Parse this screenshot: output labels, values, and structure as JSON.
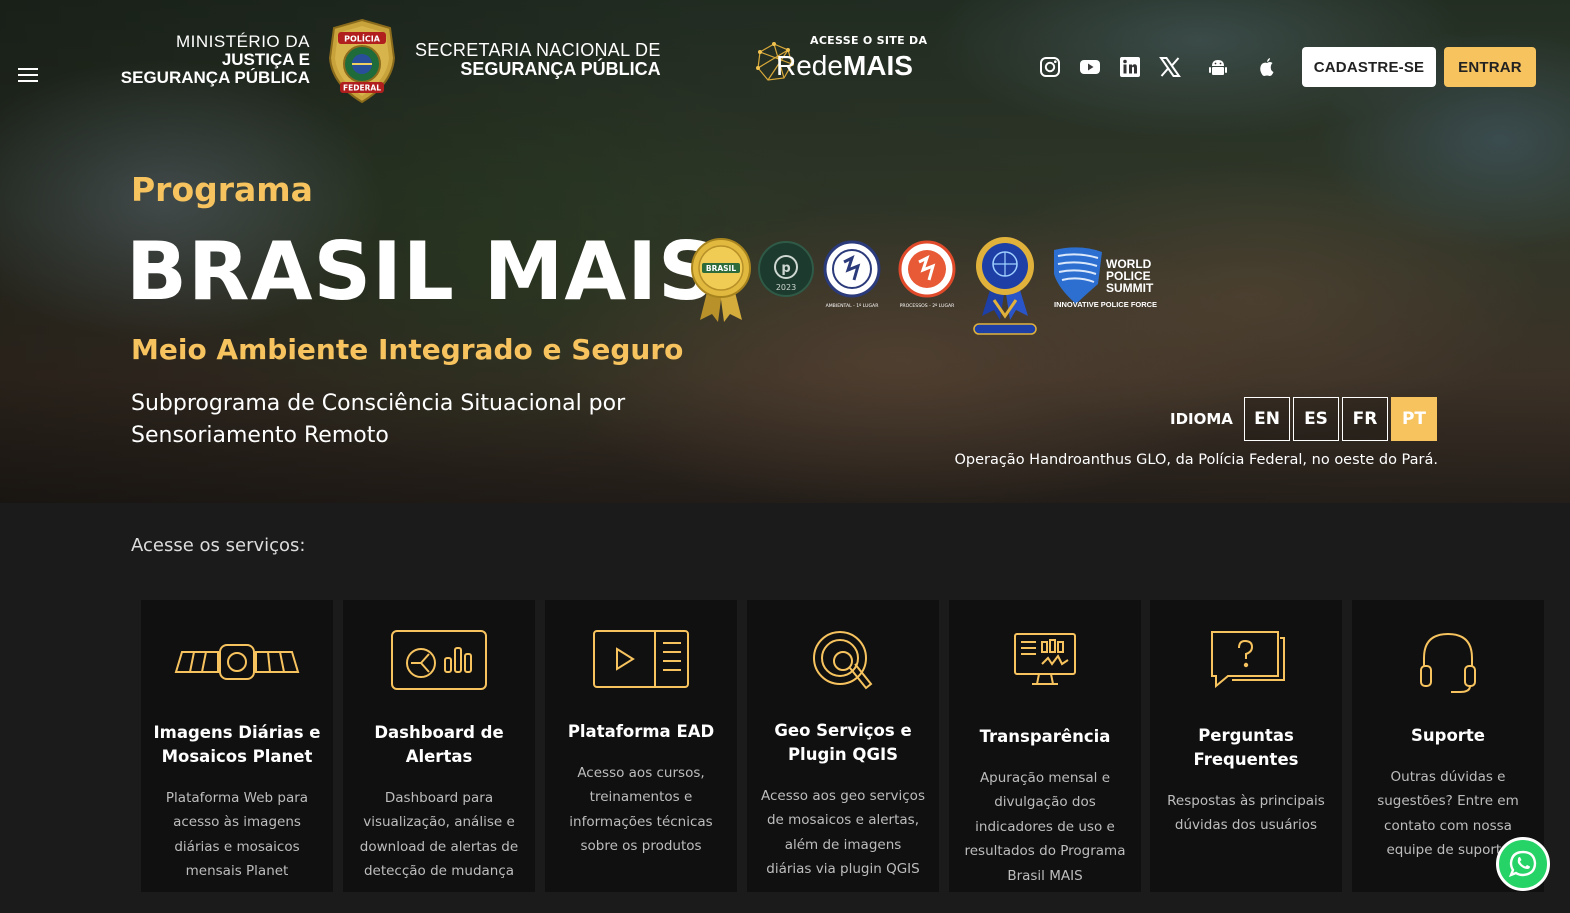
{
  "header": {
    "ministry": {
      "line1": "MINISTÉRIO DA",
      "line2": "JUSTIÇA E",
      "line3": "SEGURANÇA PÚBLICA"
    },
    "badge_text": {
      "top": "POLÍCIA",
      "bottom": "FEDERAL"
    },
    "secretaria": {
      "line1": "SECRETARIA NACIONAL DE",
      "line2": "SEGURANÇA PÚBLICA"
    },
    "rede": {
      "top": "ACESSE O SITE DA",
      "name_light": "Rede",
      "name_bold": "MAIS"
    },
    "social_icons": [
      "instagram-icon",
      "youtube-icon",
      "linkedin-icon",
      "x-icon",
      "android-icon",
      "apple-icon"
    ],
    "signup_label": "CADASTRE-SE",
    "login_label": "ENTRAR"
  },
  "hero": {
    "program_label": "Programa",
    "title": "BRASIL MAIS",
    "tagline": "Meio Ambiente Integrado e Seguro",
    "subtitle": "Subprograma de Consciência Situacional por Sensoriamento Remoto",
    "awards": {
      "a1": "BRASIL",
      "a2": "2023",
      "a3": "AMBIENTAL - 1º LUGAR",
      "a4": "PROCESSOS - 2º LUGAR",
      "a6_line1": "WORLD",
      "a6_line2": "POLICE",
      "a6_line3": "SUMMIT",
      "a6_sub": "INNOVATIVE POLICE FORCE"
    },
    "language": {
      "label": "IDIOMA",
      "options": [
        "EN",
        "ES",
        "FR",
        "PT"
      ],
      "active": "PT"
    },
    "caption": "Operação Handroanthus GLO, da Polícia Federal, no oeste do Pará."
  },
  "services": {
    "title": "Acesse os serviços:",
    "cards": [
      {
        "title": "Imagens Diárias e Mosaicos Planet",
        "desc": "Plataforma Web para acesso às imagens diárias e mosaicos mensais Planet",
        "icon": "satellite-icon"
      },
      {
        "title": "Dashboard de Alertas",
        "desc": "Dashboard para visualização, análise e download de alertas de detecção de mudança",
        "icon": "dashboard-icon"
      },
      {
        "title": "Plataforma EAD",
        "desc": "Acesso aos cursos, treinamentos e informações técnicas sobre os produtos",
        "icon": "video-course-icon"
      },
      {
        "title": "Geo Serviços e Plugin QGIS",
        "desc": "Acesso aos geo serviços de mosaicos e alertas, além de imagens diárias via plugin QGIS",
        "icon": "geo-search-icon"
      },
      {
        "title": "Transparência",
        "desc": "Apuração mensal e divulgação dos indicadores de uso e resultados do Programa Brasil MAIS",
        "icon": "monitor-chart-icon"
      },
      {
        "title": "Perguntas Frequentes",
        "desc": "Respostas às principais dúvidas dos usuários",
        "icon": "question-bubble-icon"
      },
      {
        "title": "Suporte",
        "desc": "Outras dúvidas e sugestões? Entre em contato com nossa equipe de suporte",
        "icon": "headset-icon"
      }
    ]
  },
  "colors": {
    "accent": "#f7c35f",
    "dark_bg": "#1b1b1b",
    "card_bg": "#101010",
    "whatsapp": "#25d366"
  }
}
